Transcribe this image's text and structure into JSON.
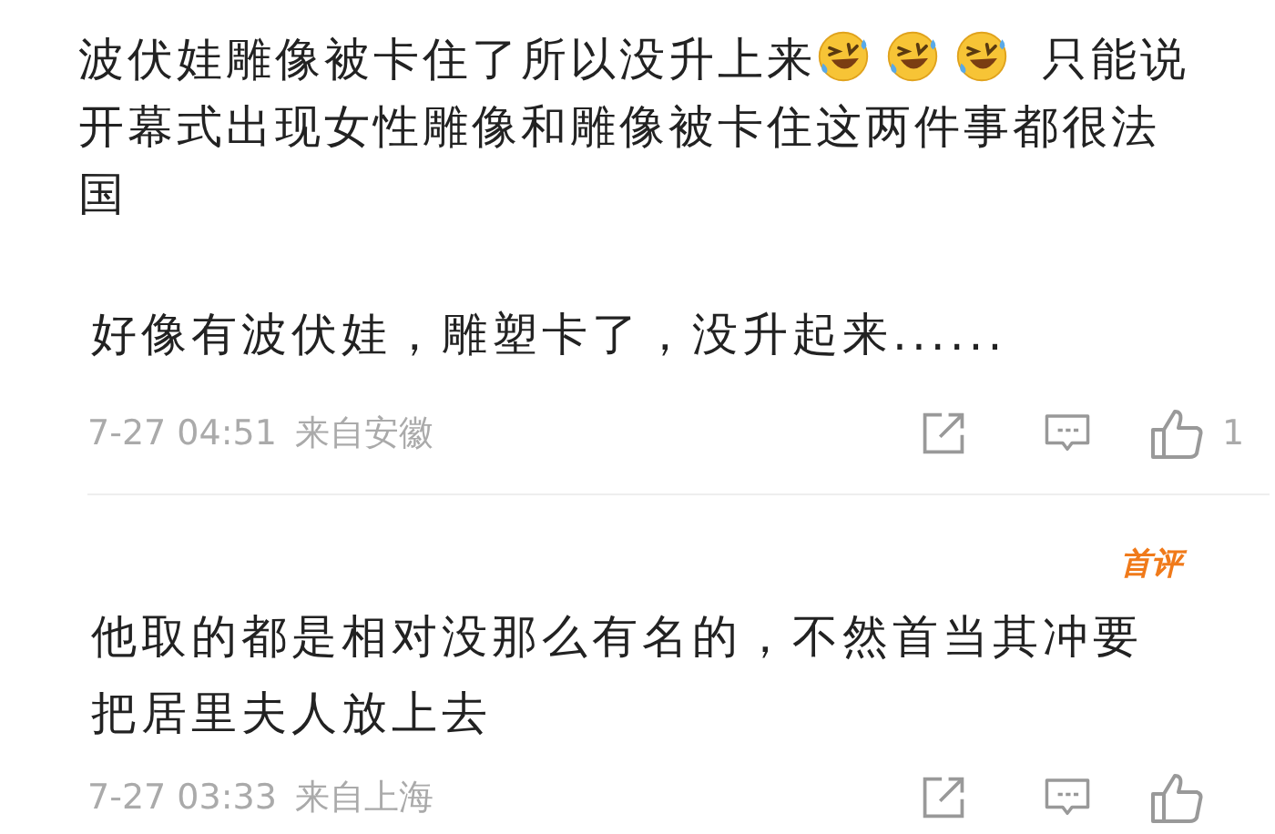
{
  "post": {
    "parts": [
      {
        "kind": "text",
        "text": "波伏娃雕像被卡住了所以没升上来"
      },
      {
        "kind": "emoji"
      },
      {
        "kind": "emoji"
      },
      {
        "kind": "emoji"
      },
      {
        "kind": "text",
        "text": " 只能说开幕式出现女性雕像和雕像被卡住这两件事都很法国"
      }
    ]
  },
  "comments": [
    {
      "text": "好像有波伏娃，雕塑卡了，没升起来......",
      "time": "7-27 04:51",
      "location": "来自安徽",
      "like_count": "1"
    },
    {
      "text": "他取的都是相对没那么有名的，不然首当其冲要把居里夫人放上去",
      "first_comment_badge": "首评",
      "time": "7-27 03:33",
      "location": "来自上海"
    }
  ]
}
